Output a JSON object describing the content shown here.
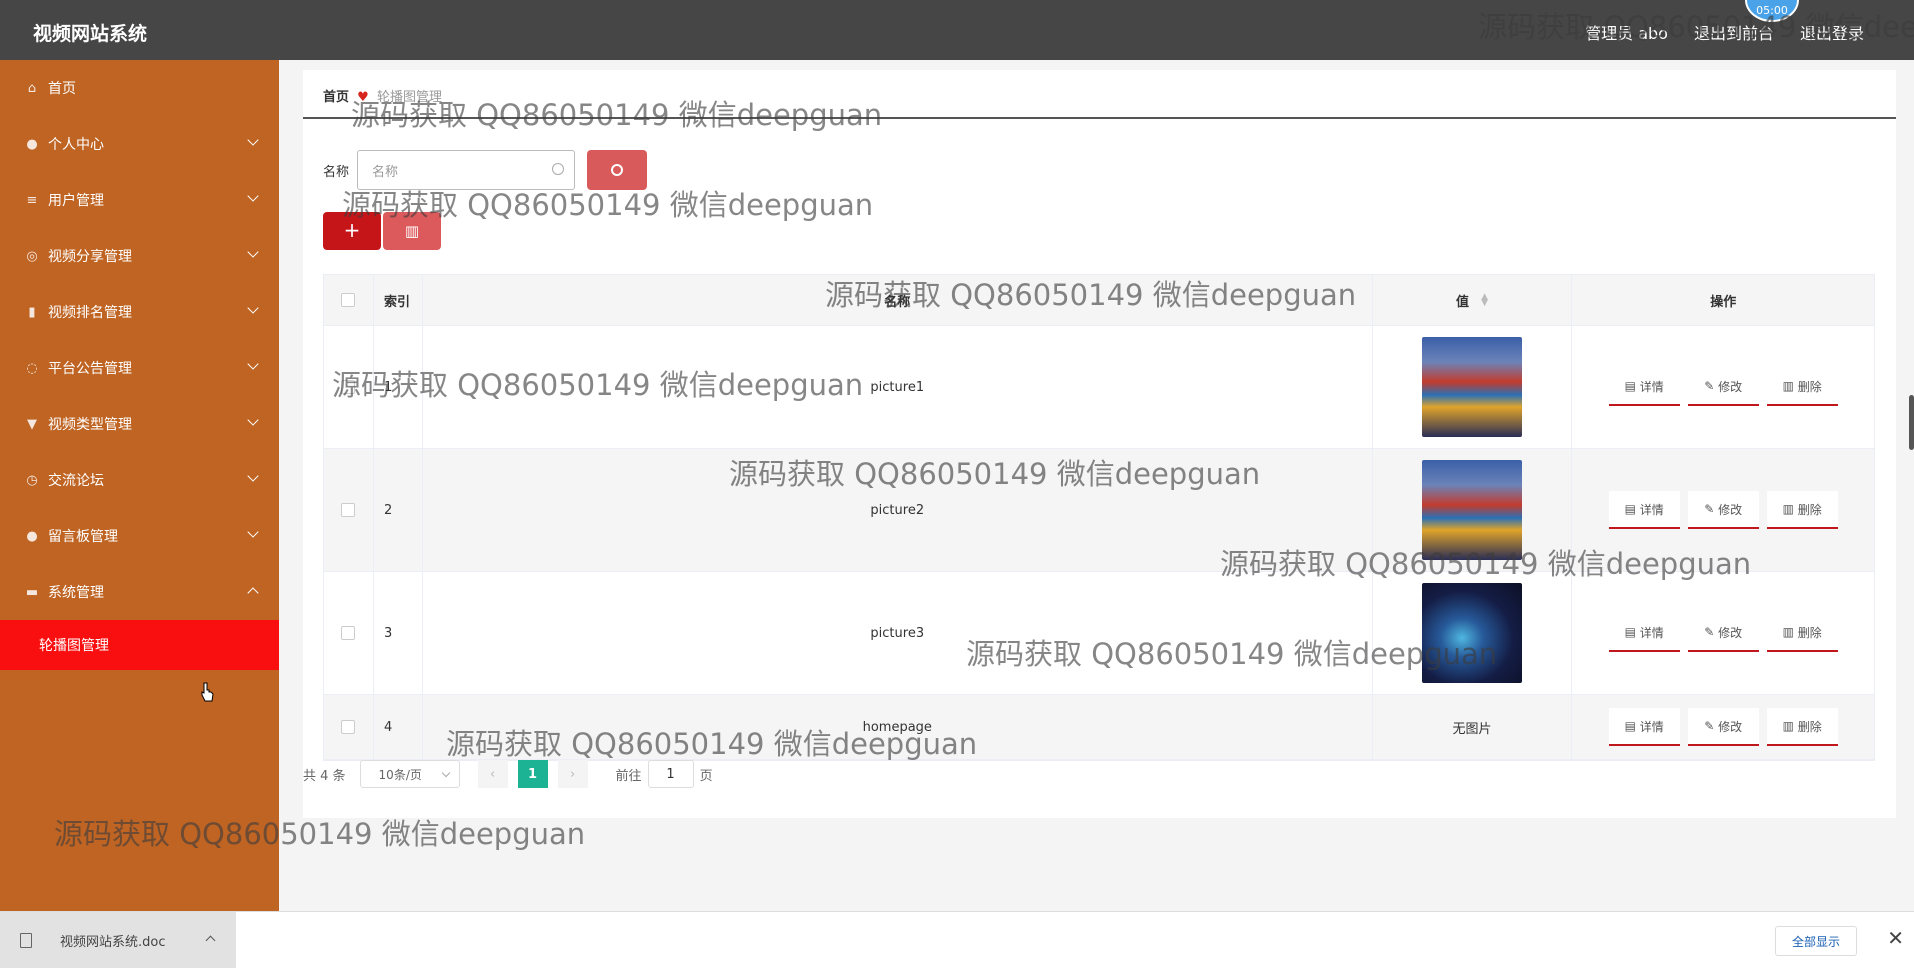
{
  "app": {
    "title": "视频网站系统"
  },
  "header": {
    "links": [
      "管理员 abo",
      "退出到前台",
      "退出登录"
    ],
    "avatar_text": "05:00"
  },
  "sidebar": {
    "items": [
      {
        "label": "首页",
        "icon": "home-icon",
        "expandable": false
      },
      {
        "label": "个人中心",
        "icon": "user-icon",
        "expandable": true
      },
      {
        "label": "用户管理",
        "icon": "list-icon",
        "expandable": true
      },
      {
        "label": "视频分享管理",
        "icon": "compass-icon",
        "expandable": true
      },
      {
        "label": "视频排名管理",
        "icon": "bar-chart-icon",
        "expandable": true
      },
      {
        "label": "平台公告管理",
        "icon": "power-icon",
        "expandable": true
      },
      {
        "label": "视频类型管理",
        "icon": "cup-icon",
        "expandable": true
      },
      {
        "label": "交流论坛",
        "icon": "clock-icon",
        "expandable": true
      },
      {
        "label": "留言板管理",
        "icon": "user-icon",
        "expandable": true
      },
      {
        "label": "系统管理",
        "icon": "folder-icon",
        "expandable": true,
        "expanded": true
      }
    ],
    "submenu": {
      "label": "轮播图管理",
      "active": true
    }
  },
  "breadcrumb": {
    "home": "首页",
    "current": "轮播图管理"
  },
  "search": {
    "label": "名称",
    "placeholder": "名称"
  },
  "table": {
    "headers": {
      "index": "索引",
      "name": "名称",
      "value": "值",
      "actions": "操作"
    },
    "rows": [
      {
        "index": "1",
        "name": "picture1",
        "image": "city",
        "value_text": ""
      },
      {
        "index": "2",
        "name": "picture2",
        "image": "city",
        "value_text": ""
      },
      {
        "index": "3",
        "name": "picture3",
        "image": "bridge",
        "value_text": ""
      },
      {
        "index": "4",
        "name": "homepage",
        "image": "",
        "value_text": "无图片"
      }
    ],
    "actions": {
      "detail": "详情",
      "edit": "修改",
      "delete": "删除"
    }
  },
  "pagination": {
    "total": "共 4 条",
    "page_size": "10条/页",
    "current_page": "1",
    "goto_label": "前往",
    "goto_value": "1",
    "page_unit": "页"
  },
  "download_bar": {
    "file": "视频网站系统.doc",
    "show_all": "全部显示",
    "close": "✕"
  },
  "watermark": "源码获取 QQ86050149 微信deepguan",
  "colors": {
    "sidebar": "#bf6423",
    "active_menu": "#f90f0f",
    "topbar": "#464646",
    "accent_green": "#1bb394",
    "button_red": "#c51519"
  }
}
